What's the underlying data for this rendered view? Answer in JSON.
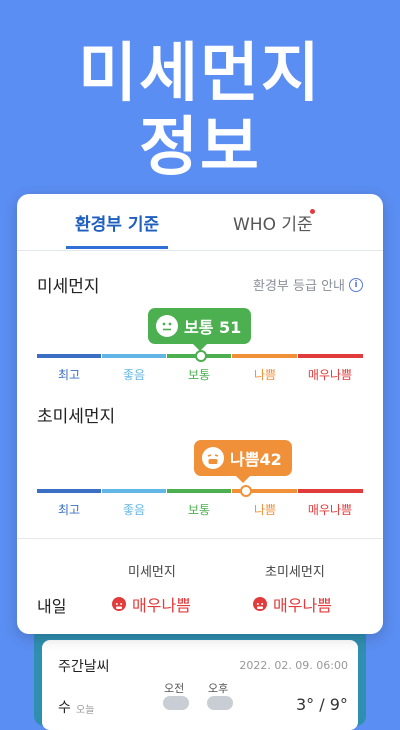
{
  "headline": {
    "line1": "미세먼지",
    "line2": "정보"
  },
  "tabs": [
    {
      "label": "환경부 기준",
      "active": true
    },
    {
      "label": "WHO 기준",
      "active": false,
      "has_dot": true
    }
  ],
  "fine_dust": {
    "title": "미세먼지",
    "guide_label": "환경부 등급 안내",
    "bubble_label": "보통 51",
    "level": "보통",
    "value": 51
  },
  "ultra_fine_dust": {
    "title": "초미세먼지",
    "bubble_label": "나쁨42",
    "level": "나쁨",
    "value": 42
  },
  "scale_levels": [
    {
      "label": "최고",
      "color": "#3a6fc4"
    },
    {
      "label": "좋음",
      "color": "#62b6e6"
    },
    {
      "label": "보통",
      "color": "#4caf50"
    },
    {
      "label": "나쁨",
      "color": "#f0913a"
    },
    {
      "label": "매우나쁨",
      "color": "#e23b3b"
    }
  ],
  "tomorrow": {
    "label": "내일",
    "col1_header": "미세먼지",
    "col2_header": "초미세먼지",
    "col1_value": "매우나쁨",
    "col2_value": "매우나쁨"
  },
  "weekly": {
    "title": "주간날씨",
    "date": "2022. 02. 09. 06:00",
    "am_label": "오전",
    "pm_label": "오후",
    "day": "수",
    "today_label": "오늘",
    "temp": "3° / 9°"
  },
  "colors": {
    "background": "#5b8ef2",
    "accent": "#1f5fbf",
    "bad_red": "#e23b3b"
  }
}
